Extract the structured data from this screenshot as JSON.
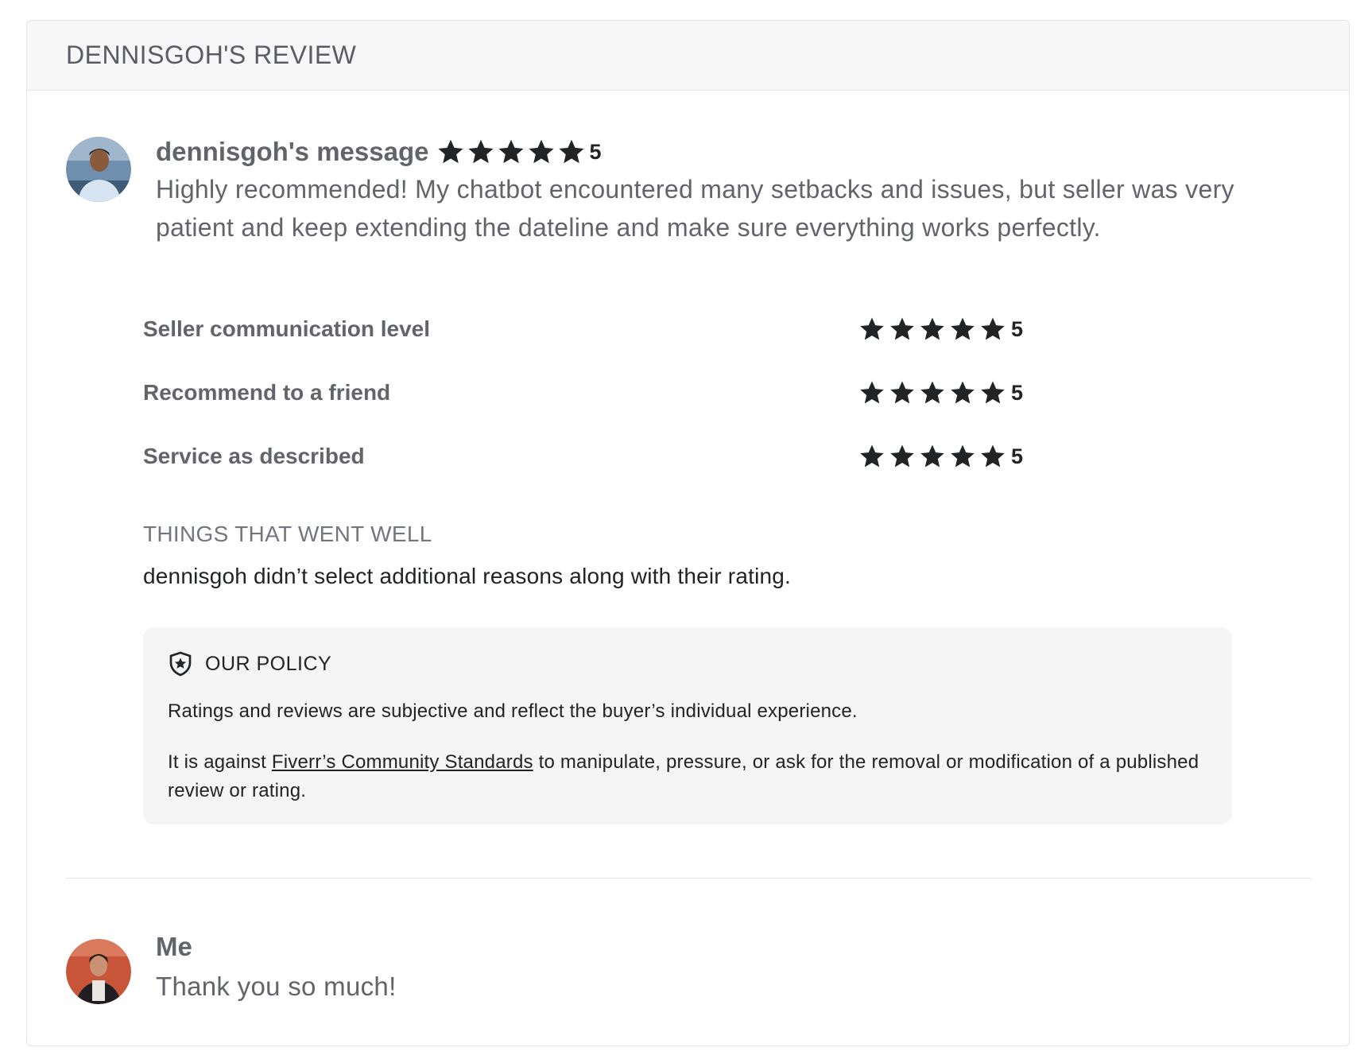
{
  "review": {
    "title": "DENNISGOH'S REVIEW",
    "buyer_message": {
      "author": "dennisgoh's message",
      "rating": "5",
      "rating_value": 5,
      "text": "Highly recommended! My chatbot encountered many setbacks and issues, but seller was very patient and keep extending the dateline and make sure everything works perfectly."
    },
    "criteria": [
      {
        "label": "Seller communication level",
        "rating": "5",
        "rating_value": 5
      },
      {
        "label": "Recommend to a friend",
        "rating": "5",
        "rating_value": 5
      },
      {
        "label": "Service as described",
        "rating": "5",
        "rating_value": 5
      }
    ],
    "things_went_well": {
      "title": "THINGS THAT WENT WELL",
      "text": "dennisgoh didn’t select additional reasons along with their rating."
    },
    "policy": {
      "title": "OUR POLICY",
      "paragraph1": "Ratings and reviews are subjective and reflect the buyer’s individual experience.",
      "paragraph2_before": "It is against ",
      "paragraph2_link": "Fiverr’s Community Standards",
      "paragraph2_after": " to manipulate, pressure, or ask for the removal or modification of a published review or rating."
    },
    "reply": {
      "author": "Me",
      "text": "Thank you so much!"
    }
  },
  "colors": {
    "star": "#222325",
    "text_muted": "#62646a",
    "header_bg": "#f7f7f7",
    "policy_bg": "#f5f5f5"
  }
}
